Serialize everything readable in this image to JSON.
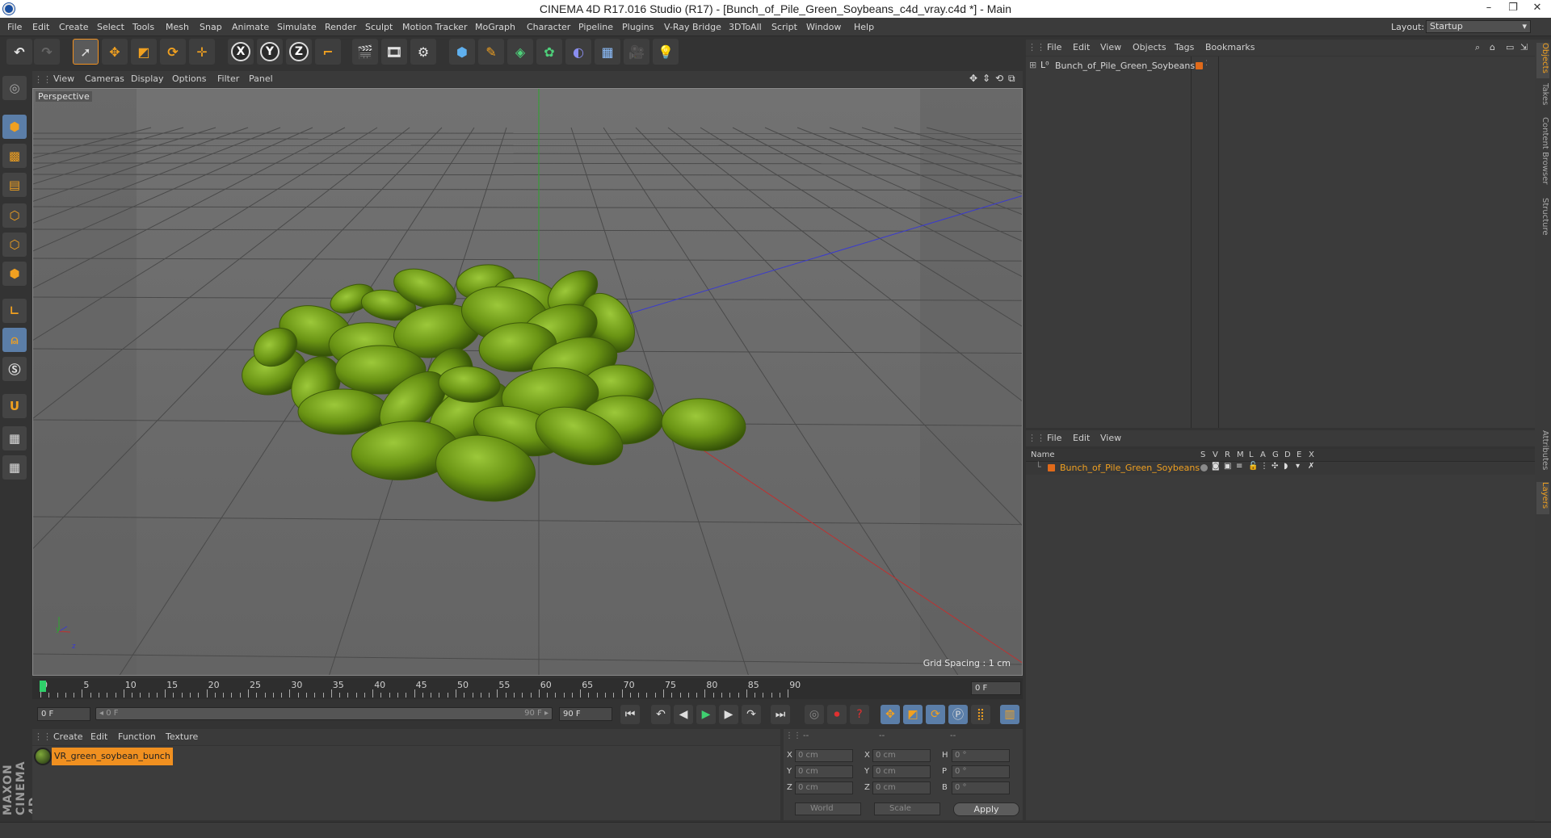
{
  "window": {
    "title": "CINEMA 4D R17.016 Studio (R17) - [Bunch_of_Pile_Green_Soybeans_c4d_vray.c4d *] - Main"
  },
  "menu": [
    "File",
    "Edit",
    "Create",
    "Select",
    "Tools",
    "Mesh",
    "Snap",
    "Animate",
    "Simulate",
    "Render",
    "Sculpt",
    "Motion Tracker",
    "MoGraph",
    "Character",
    "Pipeline",
    "Plugins",
    "V-Ray Bridge",
    "3DToAll",
    "Script",
    "Window",
    "Help"
  ],
  "layout": {
    "label": "Layout:",
    "value": "Startup"
  },
  "toolbar": {
    "axis_x": "X",
    "axis_y": "Y",
    "axis_z": "Z"
  },
  "viewport": {
    "menu": [
      "View",
      "Cameras",
      "Display",
      "Options",
      "Filter",
      "Panel"
    ],
    "label": "Perspective",
    "grid_spacing": "Grid Spacing : 1 cm",
    "axis_y": "y",
    "axis_z": "z"
  },
  "timeline": {
    "ticks": [
      "0",
      "5",
      "10",
      "15",
      "20",
      "25",
      "30",
      "35",
      "40",
      "45",
      "50",
      "55",
      "60",
      "65",
      "70",
      "75",
      "80",
      "85",
      "90"
    ],
    "current_frame": "0 F",
    "start_frame": "0 F",
    "slider_start": "◂ 0 F",
    "slider_end": "90 F ▸",
    "end_frame_a": "90 F",
    "end_frame_b": "90 F"
  },
  "material_manager": {
    "menu": [
      "Create",
      "Edit",
      "Function",
      "Texture"
    ],
    "materials": [
      {
        "name": "VR_green_soybean_bunch"
      }
    ]
  },
  "coordinates": {
    "header": [
      "--",
      "--",
      "--"
    ],
    "rows": [
      {
        "pos_label": "X",
        "pos": "0 cm",
        "size_label": "X",
        "size": "0 cm",
        "rot_label": "H",
        "rot": "0 °"
      },
      {
        "pos_label": "Y",
        "pos": "0 cm",
        "size_label": "Y",
        "size": "0 cm",
        "rot_label": "P",
        "rot": "0 °"
      },
      {
        "pos_label": "Z",
        "pos": "0 cm",
        "size_label": "Z",
        "size": "0 cm",
        "rot_label": "B",
        "rot": "0 °"
      }
    ],
    "mode_world": "World",
    "mode_scale": "Scale",
    "apply_label": "Apply"
  },
  "object_manager": {
    "menu": [
      "File",
      "Edit",
      "View",
      "Objects",
      "Tags",
      "Bookmarks"
    ],
    "objects": [
      {
        "name": "Bunch_of_Pile_Green_Soybeans",
        "color": "#e06a1a"
      }
    ]
  },
  "layer_manager": {
    "menu": [
      "File",
      "Edit",
      "View"
    ],
    "columns": [
      "Name",
      "S",
      "V",
      "R",
      "M",
      "L",
      "A",
      "G",
      "D",
      "E",
      "X"
    ],
    "layers": [
      {
        "name": "Bunch_of_Pile_Green_Soybeans",
        "color": "#e06a1a"
      }
    ]
  },
  "side_tabs": [
    "Objects",
    "Takes",
    "Content Browser",
    "Structure",
    "Attributes",
    "Layers"
  ],
  "branding": "MAXON CINEMA 4D",
  "colors": {
    "accent": "#f09020",
    "bean": "#6f9a18",
    "viewport_bg": "#6b6b6b"
  }
}
